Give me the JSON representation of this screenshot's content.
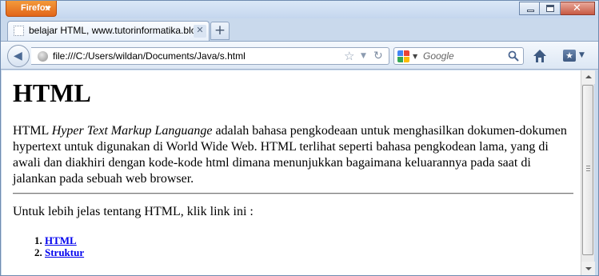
{
  "browser": {
    "app_button_label": "Firefox",
    "tab": {
      "title": "belajar HTML, www.tutorinformatika.blo..."
    },
    "new_tab_label": "+",
    "url": "file:///C:/Users/wildan/Documents/Java/s.html",
    "search": {
      "engine_icon": "google-icon",
      "placeholder": "Google"
    },
    "icons": {
      "back": "back-arrow-icon",
      "home": "home-icon",
      "bookmarks": "bookmarks-icon",
      "reload": "reload-icon",
      "star": "star-icon"
    },
    "colors": {
      "accent": "#e2661a",
      "chrome": "#c9d9ec",
      "link": "#0000ee"
    }
  },
  "page": {
    "heading": "HTML",
    "intro": {
      "lead": "HTML ",
      "emphasis": "Hyper Text Markup Languange",
      "rest": " adalah bahasa pengkodeaan untuk menghasilkan dokumen-dokumen hypertext untuk digunakan di World Wide Web. HTML terlihat seperti bahasa pengkodean lama, yang di awali dan diakhiri dengan kode-kode html dimana menunjukkan bagaimana keluarannya pada saat di jalankan pada sebuah web browser."
    },
    "links_intro": "Untuk lebih jelas tentang HTML, klik link ini :",
    "links": [
      {
        "label": "HTML"
      },
      {
        "label": "Struktur"
      }
    ]
  }
}
